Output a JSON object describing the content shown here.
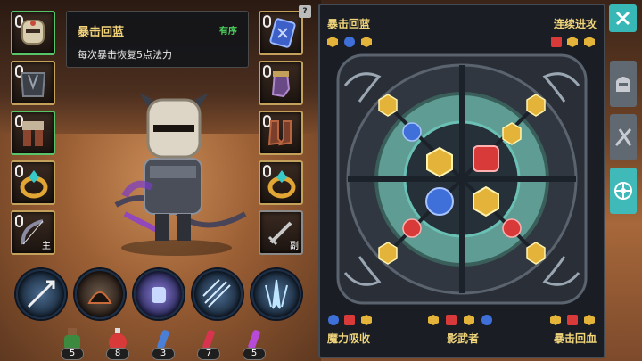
{
  "tooltip": {
    "title": "暴击回蓝",
    "tag": "有序",
    "description": "每次暴击恢复5点法力"
  },
  "equipment": {
    "left": [
      {
        "name": "helmet",
        "icon": "helmet-icon"
      },
      {
        "name": "chest-armor",
        "icon": "chest-armor-icon"
      },
      {
        "name": "leg-armor",
        "icon": "leg-armor-icon"
      },
      {
        "name": "ring",
        "icon": "ring-icon"
      },
      {
        "name": "bow",
        "icon": "bow-icon",
        "sublabel": "主"
      }
    ],
    "right": [
      {
        "name": "rune-card",
        "icon": "rune-card-icon"
      },
      {
        "name": "gloves",
        "icon": "gloves-icon"
      },
      {
        "name": "boots",
        "icon": "boots-icon"
      },
      {
        "name": "ring-2",
        "icon": "ring-icon"
      },
      {
        "name": "sword",
        "icon": "sword-icon",
        "sublabel": "副"
      }
    ]
  },
  "skills": [
    {
      "icon": "arrow-shot-icon"
    },
    {
      "icon": "shadow-beast-icon"
    },
    {
      "icon": "frost-fist-icon"
    },
    {
      "icon": "multi-arrow-icon"
    },
    {
      "icon": "ice-spike-icon"
    }
  ],
  "potions": [
    {
      "icon": "green-potion-icon",
      "count": "5",
      "color": "#3c8a3f"
    },
    {
      "icon": "red-potion-icon",
      "count": "8",
      "color": "#d83a3a"
    },
    {
      "icon": "blue-vial-icon",
      "count": "3",
      "color": "#4a7fd8"
    },
    {
      "icon": "red-vial-icon",
      "count": "7",
      "color": "#d8344f"
    },
    {
      "icon": "purple-vial-icon",
      "count": "5",
      "color": "#b84ad8"
    }
  ],
  "rune_panel": {
    "top_left_label": "暴击回蓝",
    "top_right_label": "连续进攻",
    "bottom_left_label": "魔力吸收",
    "bottom_center_label": "影武者",
    "bottom_right_label": "暴击回血"
  },
  "colors": {
    "gold": "#f1d57b",
    "accent_teal": "#3fbab9",
    "gem_gold": "#e4b43a",
    "gem_blue": "#3f6fd8",
    "gem_red": "#d83a3a"
  },
  "right_rail": {
    "close_icon": "close-icon",
    "tabs": [
      {
        "icon": "helmet-tab-icon"
      },
      {
        "icon": "weapons-tab-icon"
      },
      {
        "icon": "rune-wheel-tab-icon"
      }
    ]
  }
}
